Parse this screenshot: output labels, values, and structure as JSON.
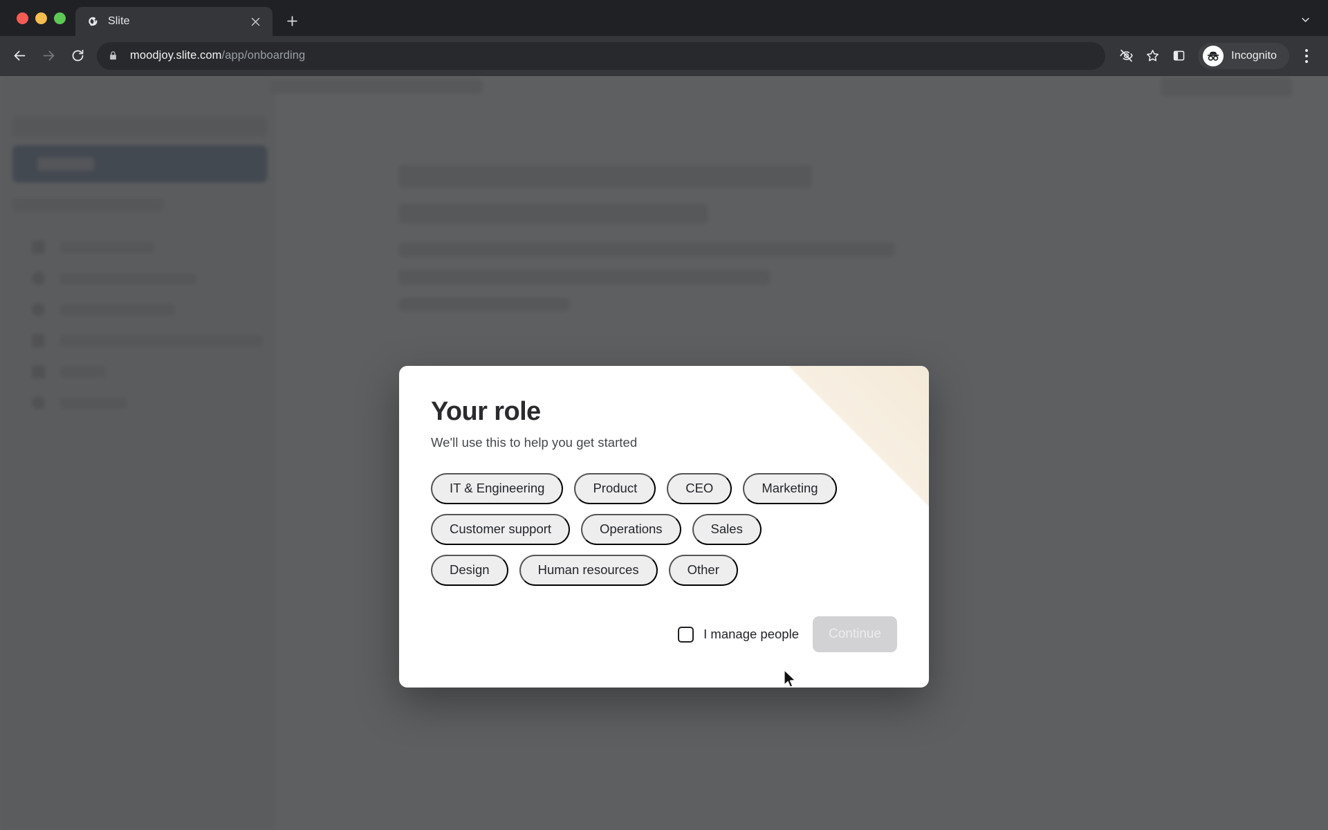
{
  "browser": {
    "window_controls": [
      "close",
      "minimize",
      "maximize"
    ],
    "tab": {
      "title": "Slite",
      "favicon_name": "slite-favicon",
      "close_label": "×"
    },
    "new_tab_label": "+",
    "tab_list_label": "⌄",
    "toolbar": {
      "back_label": "←",
      "forward_label": "→",
      "reload_label": "⟳",
      "url_host": "moodjoy.slite.com",
      "url_path": "/app/onboarding",
      "lock_icon": "lock-icon",
      "tracking_icon": "eye-off-icon",
      "bookmark_icon": "star-icon",
      "side_panel_icon": "side-panel-icon",
      "profile_label": "Incognito",
      "profile_icon": "incognito-icon",
      "menu_icon": "three-dot-menu-icon"
    }
  },
  "modal": {
    "title": "Your role",
    "subtitle": "We'll use this to help you get started",
    "roles": [
      "IT & Engineering",
      "Product",
      "CEO",
      "Marketing",
      "Customer support",
      "Operations",
      "Sales",
      "Design",
      "Human resources",
      "Other"
    ],
    "manage_people_label": "I manage people",
    "manage_people_checked": false,
    "continue_label": "Continue",
    "continue_disabled": true,
    "accent_color": "#f5ead9",
    "chip_color": "#eeeeef",
    "continue_color": "#d2d2d4"
  },
  "background_app": {
    "sidebar_rows": 6,
    "scrim_color": "rgba(32,33,36,0.72)"
  }
}
